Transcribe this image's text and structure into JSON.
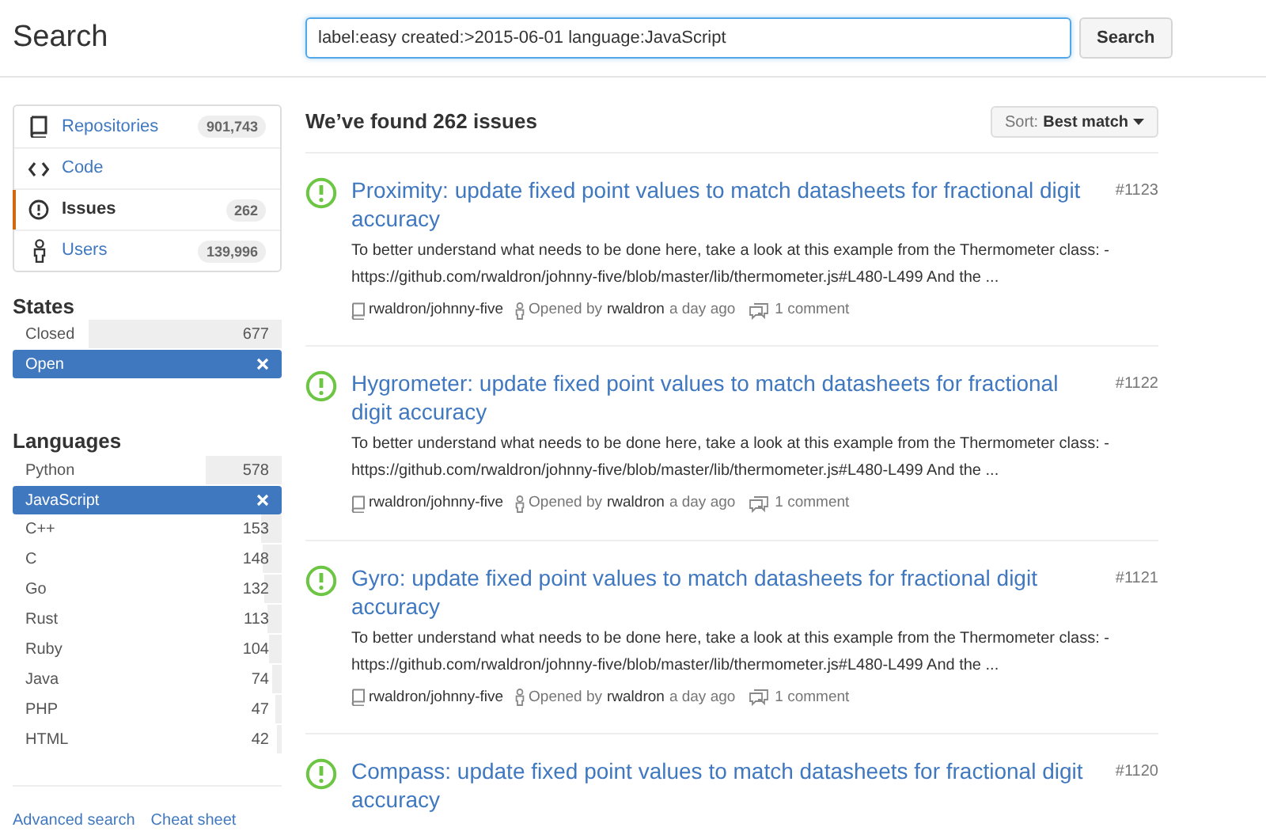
{
  "header": {
    "title": "Search",
    "query": "label:easy created:>2015-06-01 language:JavaScript",
    "button": "Search"
  },
  "sidebar": {
    "nav": [
      {
        "label": "Repositories",
        "count": "901,743",
        "selected": false
      },
      {
        "label": "Code",
        "selected": false
      },
      {
        "label": "Issues",
        "count": "262",
        "selected": true
      },
      {
        "label": "Users",
        "count": "139,996",
        "selected": false
      }
    ],
    "states": {
      "title": "States",
      "items": [
        {
          "label": "Closed",
          "count": "677",
          "selected": false,
          "level": 0.72
        },
        {
          "label": "Open",
          "selected": true
        }
      ]
    },
    "languages": {
      "title": "Languages",
      "items": [
        {
          "label": "Python",
          "count": "578",
          "selected": false,
          "level": 0.28
        },
        {
          "label": "JavaScript",
          "selected": true
        },
        {
          "label": "C++",
          "count": "153",
          "selected": false,
          "level": 0.075
        },
        {
          "label": "C",
          "count": "148",
          "selected": false,
          "level": 0.07
        },
        {
          "label": "Go",
          "count": "132",
          "selected": false,
          "level": 0.065
        },
        {
          "label": "Rust",
          "count": "113",
          "selected": false,
          "level": 0.055
        },
        {
          "label": "Ruby",
          "count": "104",
          "selected": false,
          "level": 0.05
        },
        {
          "label": "Java",
          "count": "74",
          "selected": false,
          "level": 0.035
        },
        {
          "label": "PHP",
          "count": "47",
          "selected": false,
          "level": 0.025
        },
        {
          "label": "HTML",
          "count": "42",
          "selected": false,
          "level": 0.02
        }
      ]
    },
    "links": [
      "Advanced search",
      "Cheat sheet"
    ]
  },
  "results": {
    "heading": "We’ve found 262 issues",
    "sort_label": "Sort:",
    "sort_value": "Best match",
    "issues": [
      {
        "title": "Proximity: update fixed point values to match datasheets for fractional digit accuracy",
        "number": "#1123",
        "body": "To better understand what needs to be done here, take a look at this example from the Thermometer class: - https://github.com/rwaldron/johnny-five/blob/master/lib/thermometer.js#L480-L499 And the ...",
        "repo": "rwaldron/johnny-five",
        "opened_by": "Opened by",
        "author": "rwaldron",
        "time": "a day ago",
        "comments": "1 comment"
      },
      {
        "title": "Hygrometer: update fixed point values to match datasheets for fractional digit accuracy",
        "number": "#1122",
        "body": "To better understand what needs to be done here, take a look at this example from the Thermometer class: - https://github.com/rwaldron/johnny-five/blob/master/lib/thermometer.js#L480-L499 And the ...",
        "repo": "rwaldron/johnny-five",
        "opened_by": "Opened by",
        "author": "rwaldron",
        "time": "a day ago",
        "comments": "1 comment"
      },
      {
        "title": "Gyro: update fixed point values to match datasheets for fractional digit accuracy",
        "number": "#1121",
        "body": "To better understand what needs to be done here, take a look at this example from the Thermometer class: - https://github.com/rwaldron/johnny-five/blob/master/lib/thermometer.js#L480-L499 And the ...",
        "repo": "rwaldron/johnny-five",
        "opened_by": "Opened by",
        "author": "rwaldron",
        "time": "a day ago",
        "comments": "1 comment"
      },
      {
        "title": "Compass: update fixed point values to match datasheets for fractional digit accuracy",
        "number": "#1120"
      }
    ]
  }
}
